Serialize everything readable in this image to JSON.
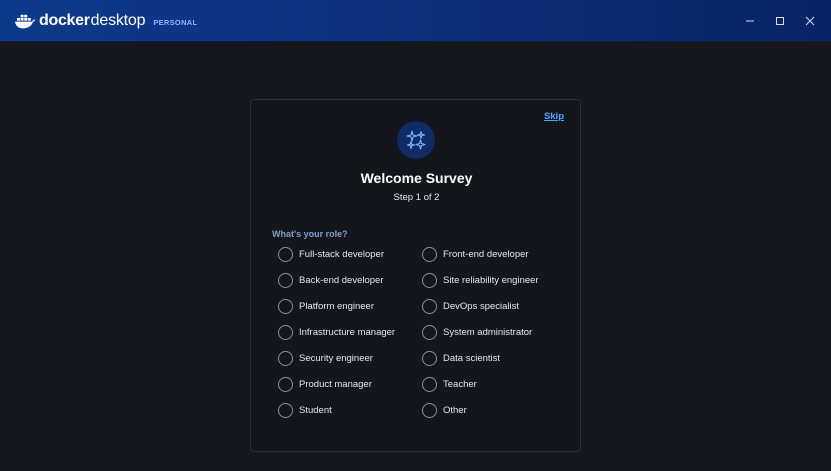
{
  "app": {
    "brand_docker": "docker",
    "brand_desktop": "desktop",
    "tier": "PERSONAL"
  },
  "window": {
    "minimize_icon": "minimize-icon",
    "maximize_icon": "maximize-icon",
    "close_icon": "close-icon"
  },
  "survey": {
    "skip_label": "Skip",
    "icon": "sparkles-icon",
    "title": "Welcome Survey",
    "step": "Step 1 of 2",
    "question": "What's your role?",
    "options_left": [
      "Full-stack developer",
      "Back-end developer",
      "Platform engineer",
      "Infrastructure manager",
      "Security engineer",
      "Product manager",
      "Student"
    ],
    "options_right": [
      "Front-end developer",
      "Site reliability engineer",
      "DevOps specialist",
      "System administrator",
      "Data scientist",
      "Teacher",
      "Other"
    ]
  },
  "colors": {
    "titlebar": "#0b2e7a",
    "background": "#16181d",
    "card": "#14161b",
    "accent": "#4aa8ff",
    "question": "#7fa1c9"
  }
}
